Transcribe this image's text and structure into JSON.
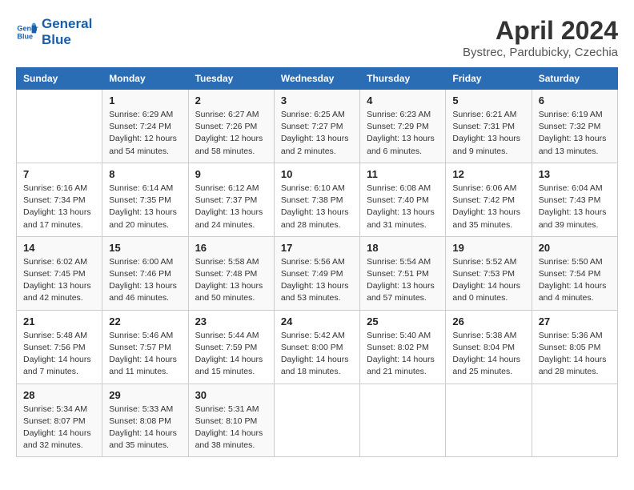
{
  "header": {
    "logo_line1": "General",
    "logo_line2": "Blue",
    "month": "April 2024",
    "location": "Bystrec, Pardubicky, Czechia"
  },
  "columns": [
    "Sunday",
    "Monday",
    "Tuesday",
    "Wednesday",
    "Thursday",
    "Friday",
    "Saturday"
  ],
  "weeks": [
    [
      {
        "day": "",
        "info": ""
      },
      {
        "day": "1",
        "info": "Sunrise: 6:29 AM\nSunset: 7:24 PM\nDaylight: 12 hours\nand 54 minutes."
      },
      {
        "day": "2",
        "info": "Sunrise: 6:27 AM\nSunset: 7:26 PM\nDaylight: 12 hours\nand 58 minutes."
      },
      {
        "day": "3",
        "info": "Sunrise: 6:25 AM\nSunset: 7:27 PM\nDaylight: 13 hours\nand 2 minutes."
      },
      {
        "day": "4",
        "info": "Sunrise: 6:23 AM\nSunset: 7:29 PM\nDaylight: 13 hours\nand 6 minutes."
      },
      {
        "day": "5",
        "info": "Sunrise: 6:21 AM\nSunset: 7:31 PM\nDaylight: 13 hours\nand 9 minutes."
      },
      {
        "day": "6",
        "info": "Sunrise: 6:19 AM\nSunset: 7:32 PM\nDaylight: 13 hours\nand 13 minutes."
      }
    ],
    [
      {
        "day": "7",
        "info": "Sunrise: 6:16 AM\nSunset: 7:34 PM\nDaylight: 13 hours\nand 17 minutes."
      },
      {
        "day": "8",
        "info": "Sunrise: 6:14 AM\nSunset: 7:35 PM\nDaylight: 13 hours\nand 20 minutes."
      },
      {
        "day": "9",
        "info": "Sunrise: 6:12 AM\nSunset: 7:37 PM\nDaylight: 13 hours\nand 24 minutes."
      },
      {
        "day": "10",
        "info": "Sunrise: 6:10 AM\nSunset: 7:38 PM\nDaylight: 13 hours\nand 28 minutes."
      },
      {
        "day": "11",
        "info": "Sunrise: 6:08 AM\nSunset: 7:40 PM\nDaylight: 13 hours\nand 31 minutes."
      },
      {
        "day": "12",
        "info": "Sunrise: 6:06 AM\nSunset: 7:42 PM\nDaylight: 13 hours\nand 35 minutes."
      },
      {
        "day": "13",
        "info": "Sunrise: 6:04 AM\nSunset: 7:43 PM\nDaylight: 13 hours\nand 39 minutes."
      }
    ],
    [
      {
        "day": "14",
        "info": "Sunrise: 6:02 AM\nSunset: 7:45 PM\nDaylight: 13 hours\nand 42 minutes."
      },
      {
        "day": "15",
        "info": "Sunrise: 6:00 AM\nSunset: 7:46 PM\nDaylight: 13 hours\nand 46 minutes."
      },
      {
        "day": "16",
        "info": "Sunrise: 5:58 AM\nSunset: 7:48 PM\nDaylight: 13 hours\nand 50 minutes."
      },
      {
        "day": "17",
        "info": "Sunrise: 5:56 AM\nSunset: 7:49 PM\nDaylight: 13 hours\nand 53 minutes."
      },
      {
        "day": "18",
        "info": "Sunrise: 5:54 AM\nSunset: 7:51 PM\nDaylight: 13 hours\nand 57 minutes."
      },
      {
        "day": "19",
        "info": "Sunrise: 5:52 AM\nSunset: 7:53 PM\nDaylight: 14 hours\nand 0 minutes."
      },
      {
        "day": "20",
        "info": "Sunrise: 5:50 AM\nSunset: 7:54 PM\nDaylight: 14 hours\nand 4 minutes."
      }
    ],
    [
      {
        "day": "21",
        "info": "Sunrise: 5:48 AM\nSunset: 7:56 PM\nDaylight: 14 hours\nand 7 minutes."
      },
      {
        "day": "22",
        "info": "Sunrise: 5:46 AM\nSunset: 7:57 PM\nDaylight: 14 hours\nand 11 minutes."
      },
      {
        "day": "23",
        "info": "Sunrise: 5:44 AM\nSunset: 7:59 PM\nDaylight: 14 hours\nand 15 minutes."
      },
      {
        "day": "24",
        "info": "Sunrise: 5:42 AM\nSunset: 8:00 PM\nDaylight: 14 hours\nand 18 minutes."
      },
      {
        "day": "25",
        "info": "Sunrise: 5:40 AM\nSunset: 8:02 PM\nDaylight: 14 hours\nand 21 minutes."
      },
      {
        "day": "26",
        "info": "Sunrise: 5:38 AM\nSunset: 8:04 PM\nDaylight: 14 hours\nand 25 minutes."
      },
      {
        "day": "27",
        "info": "Sunrise: 5:36 AM\nSunset: 8:05 PM\nDaylight: 14 hours\nand 28 minutes."
      }
    ],
    [
      {
        "day": "28",
        "info": "Sunrise: 5:34 AM\nSunset: 8:07 PM\nDaylight: 14 hours\nand 32 minutes."
      },
      {
        "day": "29",
        "info": "Sunrise: 5:33 AM\nSunset: 8:08 PM\nDaylight: 14 hours\nand 35 minutes."
      },
      {
        "day": "30",
        "info": "Sunrise: 5:31 AM\nSunset: 8:10 PM\nDaylight: 14 hours\nand 38 minutes."
      },
      {
        "day": "",
        "info": ""
      },
      {
        "day": "",
        "info": ""
      },
      {
        "day": "",
        "info": ""
      },
      {
        "day": "",
        "info": ""
      }
    ]
  ]
}
